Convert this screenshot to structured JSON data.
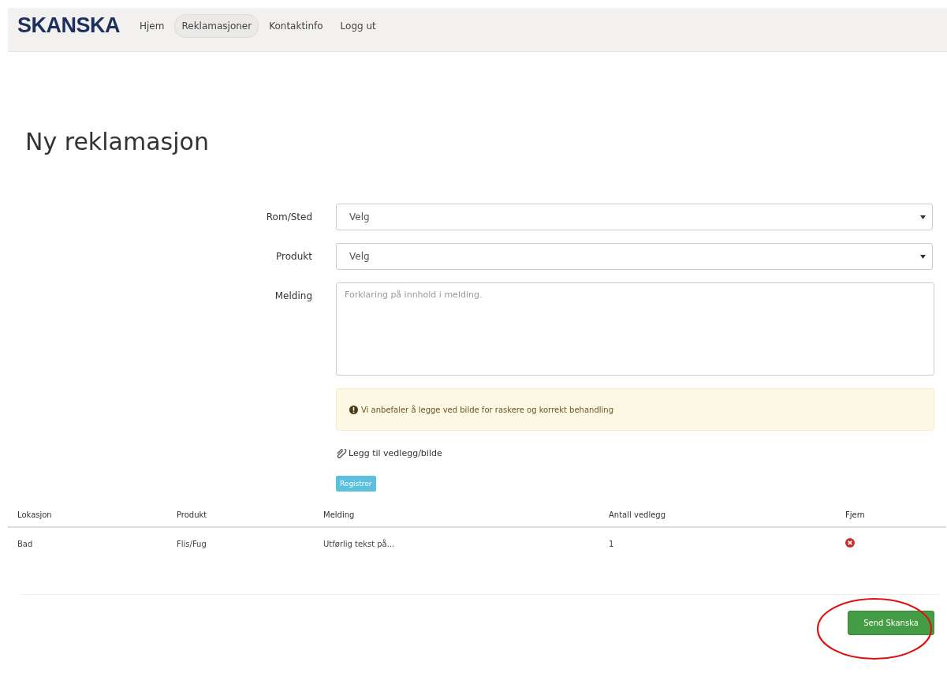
{
  "navbar": {
    "logo": "SKANSKA",
    "items": [
      {
        "label": "Hjem",
        "selected": false
      },
      {
        "label": "Reklamasjoner",
        "selected": true
      },
      {
        "label": "Kontaktinfo",
        "selected": false
      },
      {
        "label": "Logg ut",
        "selected": false
      }
    ]
  },
  "title": "Ny reklamasjon",
  "form": {
    "fields": [
      {
        "kind": "select",
        "label": "Rom/Sted",
        "value": "Velg"
      },
      {
        "kind": "select",
        "label": "Produkt",
        "value": "Velg"
      },
      {
        "kind": "textarea",
        "label": "Melding",
        "placeholder": "Forklaring på innhold i melding."
      }
    ],
    "alert": "Vi anbefaler å legge ved bilde for raskere og korrekt behandling",
    "attach_link": "Legg til vedlegg/bilde",
    "register_button": "Registrer"
  },
  "table": {
    "columns": [
      "Lokasjon",
      "Produkt",
      "Melding",
      "Antall vedlegg",
      "Fjern"
    ],
    "rows": [
      {
        "cells": [
          "Bad",
          "Flis/Fug",
          "Utførlig tekst på...",
          "1"
        ]
      }
    ]
  },
  "send_button": "Send Skanska",
  "annotation": {
    "kind": "ellipse"
  }
}
